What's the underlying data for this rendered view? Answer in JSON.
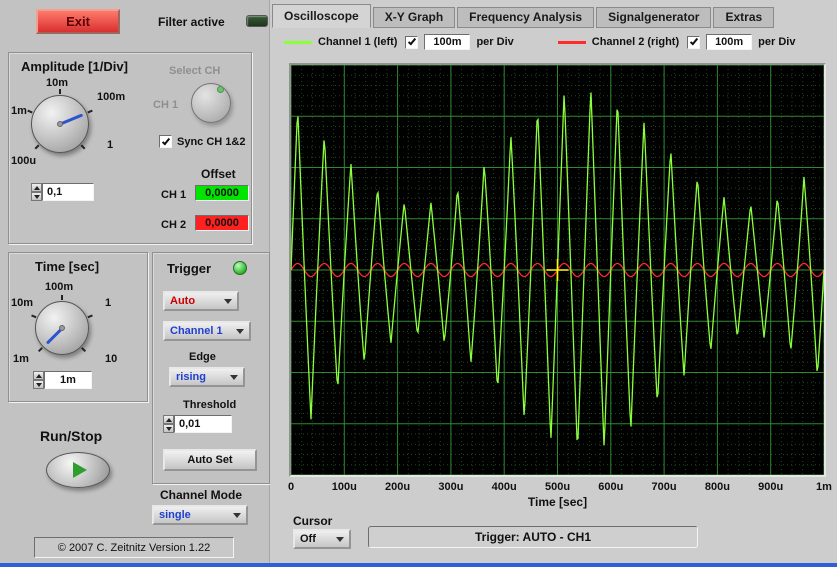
{
  "header": {
    "exit_label": "Exit",
    "filter_label": "Filter active"
  },
  "tabs": [
    {
      "label": "Oscilloscope",
      "active": true
    },
    {
      "label": "X-Y Graph",
      "active": false
    },
    {
      "label": "Frequency Analysis",
      "active": false
    },
    {
      "label": "Signalgenerator",
      "active": false
    },
    {
      "label": "Extras",
      "active": false
    }
  ],
  "legend": {
    "ch1_label": "Channel 1 (left)",
    "ch1_scale": "100m",
    "ch2_label": "Channel 2 (right)",
    "ch2_scale": "100m",
    "per_div": "per Div"
  },
  "amplitude": {
    "title": "Amplitude [1/Div]",
    "labels": [
      "10m",
      "100m",
      "1",
      "1m",
      "100u"
    ],
    "value": "0,1",
    "select_ch_label": "Select CH",
    "ch_label": "CH 1",
    "sync_label": "Sync CH 1&2",
    "offset_title": "Offset",
    "offset_ch1_label": "CH 1",
    "offset_ch1_value": "0,0000",
    "offset_ch1_color": "#00e400",
    "offset_ch2_label": "CH 2",
    "offset_ch2_value": "0,0000",
    "offset_ch2_color": "#ff2020"
  },
  "time": {
    "title": "Time [sec]",
    "labels": [
      "100m",
      "10m",
      "1",
      "1m",
      "10"
    ],
    "value": "1m"
  },
  "trigger": {
    "title": "Trigger",
    "mode": "Auto",
    "source": "Channel 1",
    "edge_label": "Edge",
    "edge": "rising",
    "threshold_label": "Threshold",
    "threshold": "0,01",
    "autoset_label": "Auto Set"
  },
  "run_stop_label": "Run/Stop",
  "channel_mode": {
    "label": "Channel Mode",
    "value": "single"
  },
  "copyright": "© 2007  C. Zeitnitz Version 1.22",
  "cursor_panel": {
    "label": "Cursor",
    "value": "Off"
  },
  "status_bar": "Trigger: AUTO - CH1",
  "chart_data": {
    "type": "line",
    "xlabel": "Time [sec]",
    "x_ticks": [
      "0",
      "100u",
      "200u",
      "300u",
      "400u",
      "500u",
      "600u",
      "700u",
      "800u",
      "900u",
      "1m"
    ],
    "x_range_sec": [
      0,
      0.001
    ],
    "divisions_x": 10,
    "divisions_y": 8,
    "minor_per_division": 5,
    "background": "#000000",
    "grid_major_color": "#2e8b2e",
    "grid_minor_color": "#1b4d1b",
    "series": [
      {
        "name": "Channel 1 (left)",
        "color": "#8cff3c",
        "shape": "triangle",
        "cycles": 20,
        "volts_per_div": "100m",
        "base_amplitude": 0.64,
        "beat_depth": 0.3,
        "beat_cycles": 1.6,
        "beat_phase": -3.96
      },
      {
        "name": "Channel 2 (right)",
        "color": "#ff2a2a",
        "shape": "sine",
        "cycles": 20,
        "volts_per_div": "100m",
        "amplitude": 0.016
      }
    ],
    "cursor": {
      "x_frac": 0.5,
      "y_frac": 0.5,
      "color": "#ffff00"
    }
  }
}
